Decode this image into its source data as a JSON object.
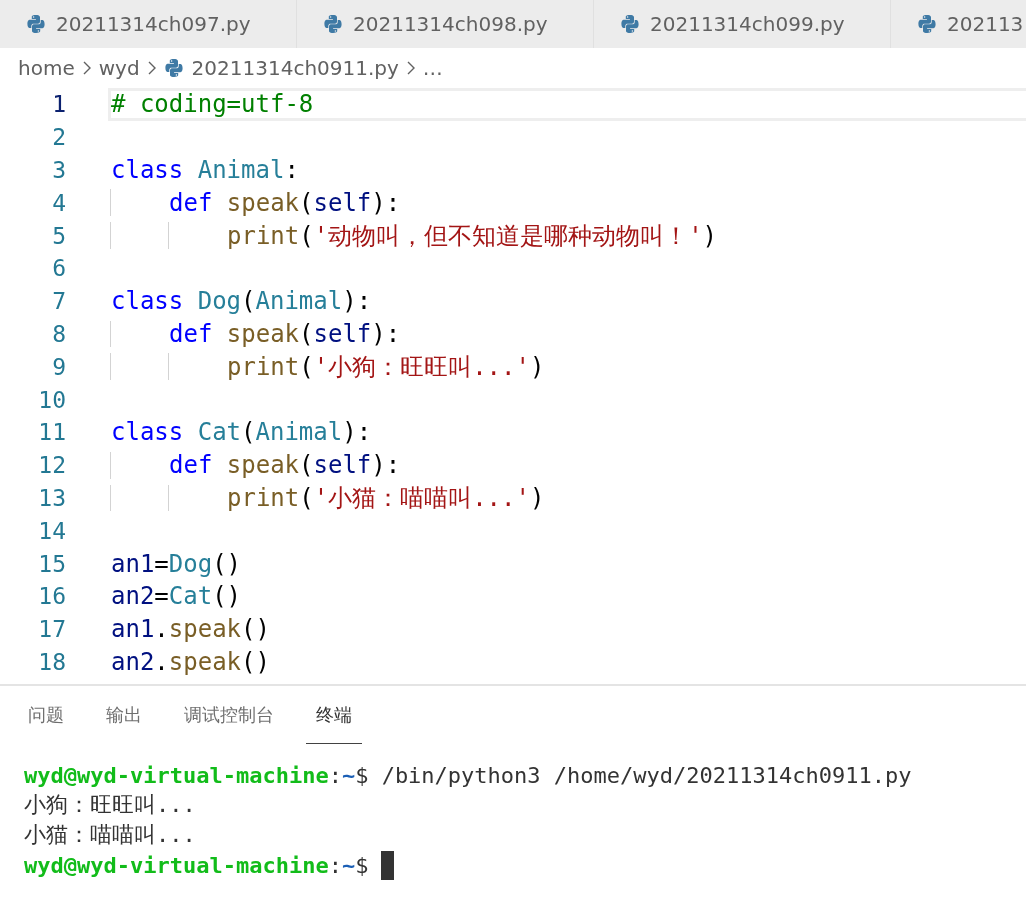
{
  "tabs": [
    {
      "label": "20211314ch097.py",
      "selected": false
    },
    {
      "label": "20211314ch098.py",
      "selected": false
    },
    {
      "label": "20211314ch099.py",
      "selected": false
    },
    {
      "label": "202113",
      "selected": false
    }
  ],
  "breadcrumb": [
    {
      "label": "home",
      "kind": "folder"
    },
    {
      "label": "wyd",
      "kind": "folder"
    },
    {
      "label": "20211314ch0911.py",
      "kind": "file"
    },
    {
      "label": "…",
      "kind": "more"
    }
  ],
  "editor": {
    "lines": [
      {
        "number": "1",
        "current": true,
        "tokens": [
          {
            "kind": "comment",
            "text": "# coding=utf-8"
          }
        ]
      },
      {
        "number": "2",
        "current": false
      },
      {
        "number": "3",
        "current": false,
        "tokens": [
          {
            "kind": "keyword",
            "text": "class"
          },
          {
            "kind": "type",
            "text": "Animal",
            "space": true
          },
          {
            "kind": "plain",
            "text": ":"
          }
        ],
        "children": [
          {
            "number": "4",
            "current": false,
            "tokens": [
              {
                "kind": "keyword",
                "text": "def"
              },
              {
                "kind": "func",
                "text": "speak",
                "space": true
              },
              {
                "kind": "plain",
                "text": "("
              },
              {
                "kind": "var",
                "text": "self"
              },
              {
                "kind": "plain",
                "text": "):"
              }
            ],
            "children": [
              {
                "number": "5",
                "current": false,
                "tokens": [
                  {
                    "kind": "func",
                    "text": "print"
                  },
                  {
                    "kind": "plain",
                    "text": "("
                  },
                  {
                    "kind": "string",
                    "text": "'动物叫，但不知道是哪种动物叫！'"
                  },
                  {
                    "kind": "plain",
                    "text": ")"
                  }
                ]
              }
            ]
          }
        ]
      },
      {
        "number": "6",
        "current": false
      },
      {
        "number": "7",
        "current": false,
        "tokens": [
          {
            "kind": "keyword",
            "text": "class"
          },
          {
            "kind": "type",
            "text": "Dog",
            "space": true
          },
          {
            "kind": "plain",
            "text": "("
          },
          {
            "kind": "type",
            "text": "Animal"
          },
          {
            "kind": "plain",
            "text": "):"
          }
        ],
        "children": [
          {
            "number": "8",
            "current": false,
            "tokens": [
              {
                "kind": "keyword",
                "text": "def"
              },
              {
                "kind": "func",
                "text": "speak",
                "space": true
              },
              {
                "kind": "plain",
                "text": "("
              },
              {
                "kind": "var",
                "text": "self"
              },
              {
                "kind": "plain",
                "text": "):"
              }
            ],
            "children": [
              {
                "number": "9",
                "current": false,
                "tokens": [
                  {
                    "kind": "func",
                    "text": "print"
                  },
                  {
                    "kind": "plain",
                    "text": "("
                  },
                  {
                    "kind": "string",
                    "text": "'小狗：旺旺叫...'"
                  },
                  {
                    "kind": "plain",
                    "text": ")"
                  }
                ]
              }
            ]
          }
        ]
      },
      {
        "number": "10",
        "current": false
      },
      {
        "number": "11",
        "current": false,
        "tokens": [
          {
            "kind": "keyword",
            "text": "class"
          },
          {
            "kind": "type",
            "text": "Cat",
            "space": true
          },
          {
            "kind": "plain",
            "text": "("
          },
          {
            "kind": "type",
            "text": "Animal"
          },
          {
            "kind": "plain",
            "text": "):"
          }
        ],
        "children": [
          {
            "number": "12",
            "current": false,
            "tokens": [
              {
                "kind": "keyword",
                "text": "def"
              },
              {
                "kind": "func",
                "text": "speak",
                "space": true
              },
              {
                "kind": "plain",
                "text": "("
              },
              {
                "kind": "var",
                "text": "self"
              },
              {
                "kind": "plain",
                "text": "):"
              }
            ],
            "children": [
              {
                "number": "13",
                "current": false,
                "tokens": [
                  {
                    "kind": "func",
                    "text": "print"
                  },
                  {
                    "kind": "plain",
                    "text": "("
                  },
                  {
                    "kind": "string",
                    "text": "'小猫：喵喵叫...'"
                  },
                  {
                    "kind": "plain",
                    "text": ")"
                  }
                ]
              }
            ]
          }
        ]
      },
      {
        "number": "14",
        "current": false
      },
      {
        "number": "15",
        "current": false,
        "tokens": [
          {
            "kind": "var",
            "text": "an1"
          },
          {
            "kind": "plain",
            "text": "="
          },
          {
            "kind": "type",
            "text": "Dog"
          },
          {
            "kind": "plain",
            "text": "()"
          }
        ]
      },
      {
        "number": "16",
        "current": false,
        "tokens": [
          {
            "kind": "var",
            "text": "an2"
          },
          {
            "kind": "plain",
            "text": "="
          },
          {
            "kind": "type",
            "text": "Cat"
          },
          {
            "kind": "plain",
            "text": "()"
          }
        ]
      },
      {
        "number": "17",
        "current": false,
        "tokens": [
          {
            "kind": "var",
            "text": "an1"
          },
          {
            "kind": "plain",
            "text": "."
          },
          {
            "kind": "func",
            "text": "speak"
          },
          {
            "kind": "plain",
            "text": "()"
          }
        ]
      },
      {
        "number": "18",
        "current": false,
        "tokens": [
          {
            "kind": "var",
            "text": "an2"
          },
          {
            "kind": "plain",
            "text": "."
          },
          {
            "kind": "func",
            "text": "speak"
          },
          {
            "kind": "plain",
            "text": "()"
          }
        ]
      }
    ]
  },
  "panel_tabs": [
    {
      "label": "问题",
      "selected": false
    },
    {
      "label": "输出",
      "selected": false
    },
    {
      "label": "调试控制台",
      "selected": false
    },
    {
      "label": "终端",
      "selected": true
    }
  ],
  "terminal": {
    "lines": [
      {
        "cursor": false,
        "segments": [
          {
            "kind": "user",
            "text": "wyd@wyd-virtual-machine"
          },
          {
            "kind": "plain",
            "text": ":"
          },
          {
            "kind": "path",
            "text": "~"
          },
          {
            "kind": "plain",
            "text": "$ /bin/python3 /home/wyd/20211314ch0911.py"
          }
        ]
      },
      {
        "cursor": false,
        "segments": [
          {
            "kind": "plain",
            "text": "小狗：旺旺叫..."
          }
        ]
      },
      {
        "cursor": false,
        "segments": [
          {
            "kind": "plain",
            "text": "小猫：喵喵叫..."
          }
        ]
      },
      {
        "cursor": true,
        "segments": [
          {
            "kind": "user",
            "text": "wyd@wyd-virtual-machine"
          },
          {
            "kind": "plain",
            "text": ":"
          },
          {
            "kind": "path",
            "text": "~"
          },
          {
            "kind": "plain",
            "text": "$"
          }
        ]
      }
    ]
  }
}
